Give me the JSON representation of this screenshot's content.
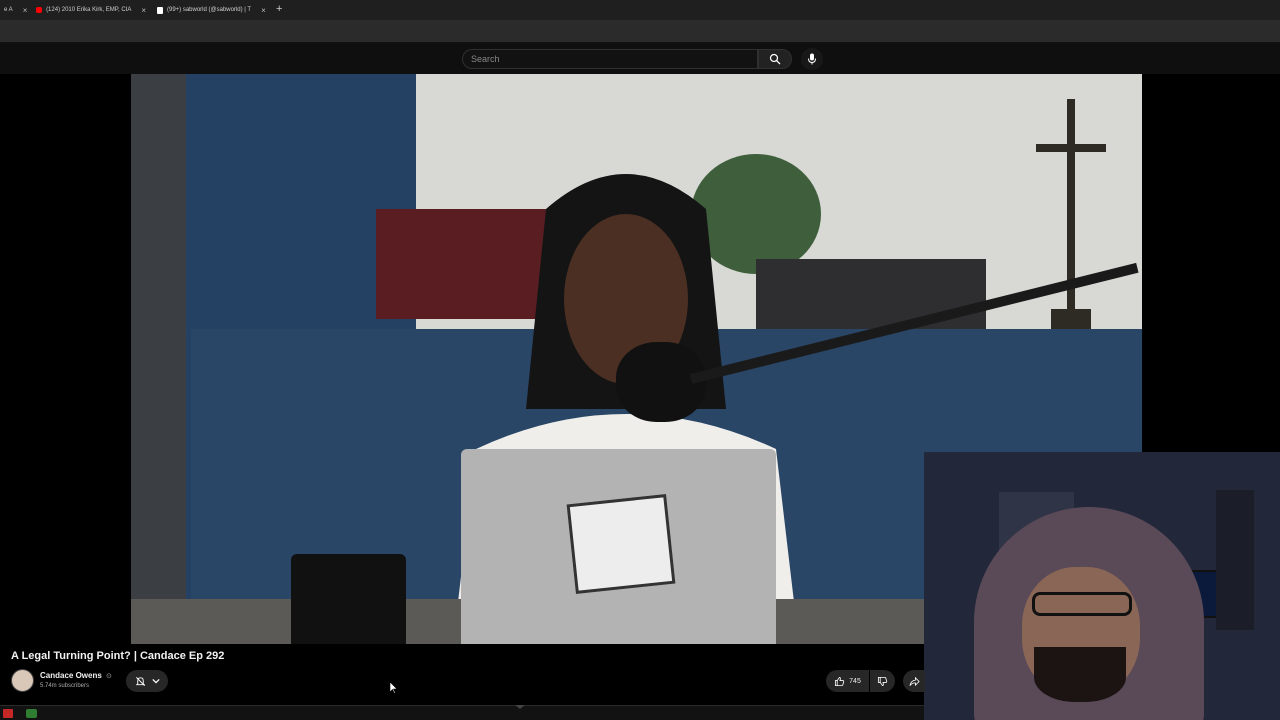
{
  "browser": {
    "tabs": [
      {
        "label": "e A",
        "favicon": "page-icon"
      },
      {
        "label": "(124) 2010 Erika Kirk, EMP, CIA",
        "favicon": "youtube-icon"
      },
      {
        "label": "(99+) sabworld (@sabworld) | T",
        "favicon": "tiktok-icon"
      }
    ],
    "new_tab_label": "+"
  },
  "youtube": {
    "search_placeholder": "Search",
    "video": {
      "title": "A Legal Turning Point? | Candace Ep 292",
      "channel_name": "Candace Owens",
      "verified_mark": "⊙",
      "subscribers": "5.74m subscribers",
      "like_count": "745"
    }
  },
  "colors": {
    "background": "#0f0f0f",
    "button_bg": "#272727",
    "text_primary": "#f1f1f1",
    "text_secondary": "#aaaaaa"
  }
}
